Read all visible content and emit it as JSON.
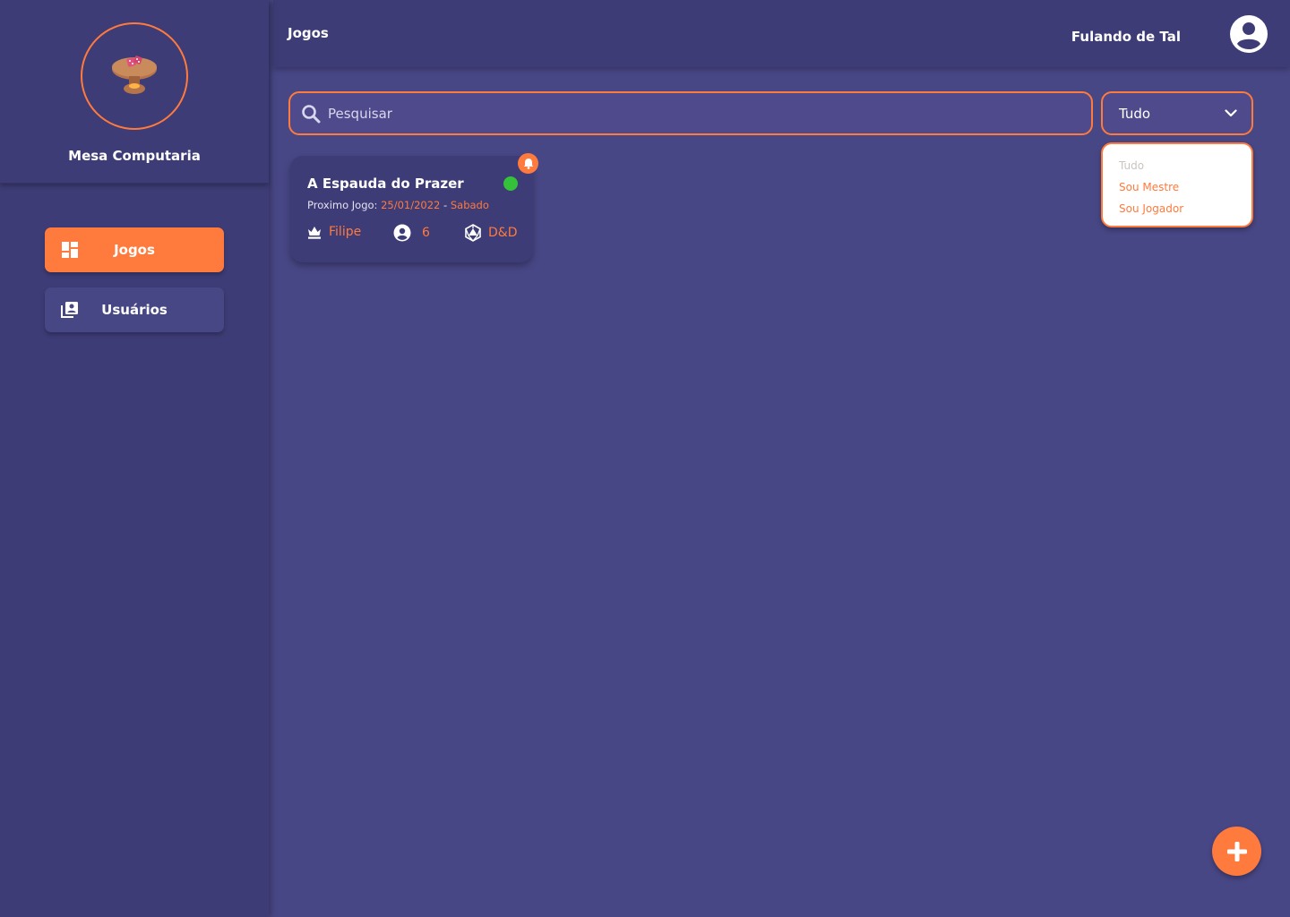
{
  "brand": {
    "name": "Mesa Computaria"
  },
  "sidebar": {
    "items": [
      {
        "label": "Jogos",
        "icon": "dashboard-icon",
        "active": true
      },
      {
        "label": "Usuários",
        "icon": "contacts-icon",
        "active": false
      }
    ]
  },
  "header": {
    "title": "Jogos",
    "user_name": "Fulando de Tal"
  },
  "search": {
    "placeholder": "Pesquisar",
    "value": ""
  },
  "filter": {
    "selected": "Tudo",
    "options": [
      "Tudo",
      "Sou Mestre",
      "Sou Jogador"
    ]
  },
  "games": [
    {
      "title": "A Espauda do Prazer",
      "next_label": "Proximo Jogo:",
      "next_date": "25/01/2022",
      "separator": "-",
      "next_day": "Sabado",
      "master": "Filipe",
      "players": "6",
      "system": "D&D",
      "status": "online",
      "has_notification": true
    }
  ],
  "colors": {
    "accent": "#ff7a3d",
    "background": "#484786",
    "panel": "#3e3c76",
    "status_online": "#33c23a"
  }
}
